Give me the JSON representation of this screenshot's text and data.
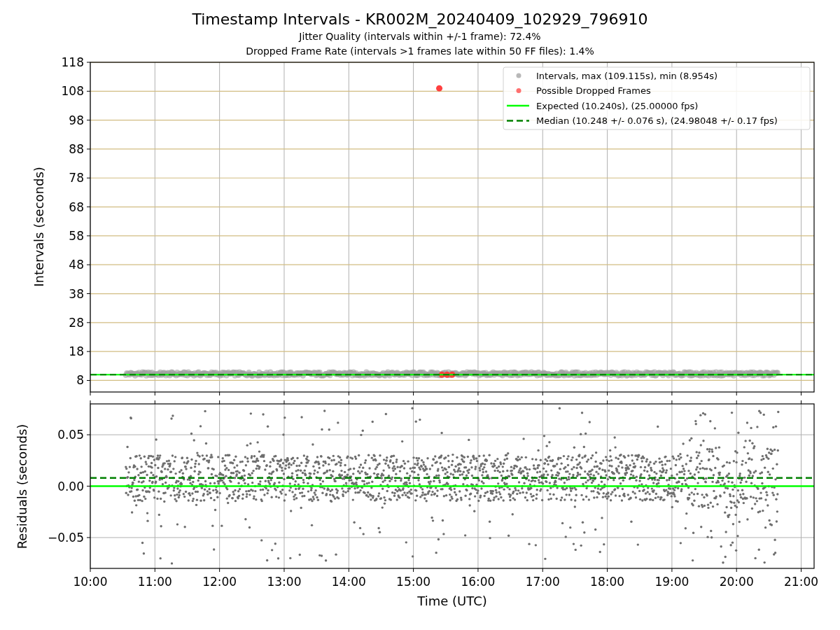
{
  "figure": {
    "title": "Timestamp Intervals - KR002M_20240409_102929_796910",
    "subtitles": [
      "Jitter Quality (intervals within +/-1 frame): 72.4%",
      "Dropped Frame Rate (intervals >1 frames late within 50 FF files): 1.4%"
    ]
  },
  "charts": [
    {
      "chart_data": {
        "type": "scatter",
        "ylabel": "Intervals (seconds)",
        "xlim": [
          10,
          21.2
        ],
        "ylim": [
          4,
          118
        ],
        "yticks": [
          8,
          18,
          28,
          38,
          48,
          58,
          68,
          78,
          88,
          98,
          108,
          118
        ],
        "grid": true,
        "legend": true,
        "series": [
          {
            "name": "Intervals, max (109.115s), min (8.954s)",
            "color": "#a0a0a0"
          },
          {
            "name": "Possible Dropped Frames",
            "color": "#ff4040",
            "x": [
              15.4,
              15.44,
              15.52,
              15.6
            ],
            "values": [
              109,
              10,
              10,
              10
            ]
          }
        ],
        "ref_lines": [
          {
            "label": "Expected (10.240s), (25.00000 fps)",
            "axis": "y",
            "value": 10,
            "color": "#00ff00"
          },
          {
            "label": "Median (10.248 +/- 0.076 s), (24.98048 +/- 0.17 fps)",
            "axis": "y",
            "value": 10,
            "color": "#008000"
          }
        ]
      }
    },
    {
      "chart_data": {
        "type": "scatter",
        "xlabel": "Time (UTC)",
        "ylabel": "Residuals (seconds)",
        "xlim": [
          10,
          21.2
        ],
        "ylim": [
          -0.08,
          0.08
        ],
        "grid": true,
        "xticks": [
          {
            "value": 10,
            "label": "10:00"
          },
          {
            "value": 11,
            "label": "11:00"
          },
          {
            "value": 12,
            "label": "12:00"
          },
          {
            "value": 13,
            "label": "13:00"
          },
          {
            "value": 14,
            "label": "14:00"
          },
          {
            "value": 15,
            "label": "15:00"
          },
          {
            "value": 16,
            "label": "16:00"
          },
          {
            "value": 17,
            "label": "17:00"
          },
          {
            "value": 18,
            "label": "18:00"
          },
          {
            "value": 19,
            "label": "19:00"
          },
          {
            "value": 20,
            "label": "20:00"
          },
          {
            "value": 21,
            "label": "21:00"
          }
        ],
        "yticks": [
          {
            "value": 0.05,
            "label": "0.05"
          },
          {
            "value": 0,
            "label": "0.00"
          },
          {
            "value": -0.05,
            "label": "−0.05"
          }
        ],
        "ref_lines": [
          {
            "axis": "y",
            "value": 0,
            "color": "#00ff00"
          },
          {
            "axis": "y",
            "value": 0.008,
            "color": "#008000"
          }
        ]
      }
    }
  ]
}
